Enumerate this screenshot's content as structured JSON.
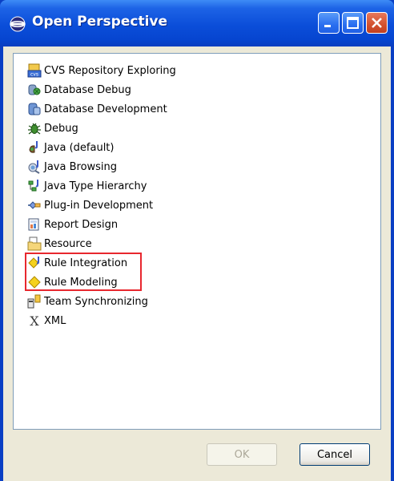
{
  "window": {
    "title": "Open Perspective",
    "title_icon": "eclipse-perspective-icon",
    "controls": [
      "minimize",
      "maximize",
      "close"
    ]
  },
  "perspectives": [
    {
      "label": "CVS Repository Exploring",
      "icon": "cvs-repository-icon"
    },
    {
      "label": "Database Debug",
      "icon": "database-debug-icon"
    },
    {
      "label": "Database Development",
      "icon": "database-development-icon"
    },
    {
      "label": "Debug",
      "icon": "debug-bug-icon"
    },
    {
      "label": "Java (default)",
      "icon": "java-icon"
    },
    {
      "label": "Java Browsing",
      "icon": "java-browsing-icon"
    },
    {
      "label": "Java Type Hierarchy",
      "icon": "java-type-hierarchy-icon"
    },
    {
      "label": "Plug-in Development",
      "icon": "plugin-development-icon"
    },
    {
      "label": "Report Design",
      "icon": "report-design-icon"
    },
    {
      "label": "Resource",
      "icon": "resource-folder-icon"
    },
    {
      "label": "Rule Integration",
      "icon": "rule-integration-icon"
    },
    {
      "label": "Rule Modeling",
      "icon": "rule-modeling-icon"
    },
    {
      "label": "Team Synchronizing",
      "icon": "team-synchronizing-icon"
    },
    {
      "label": "XML",
      "icon": "xml-icon"
    }
  ],
  "buttons": {
    "ok": "OK",
    "cancel": "Cancel",
    "ok_enabled": false
  },
  "colors": {
    "titlebar": "#0b4ed9",
    "highlight_box": "#e8272e",
    "dialog_bg": "#ece9d8"
  }
}
